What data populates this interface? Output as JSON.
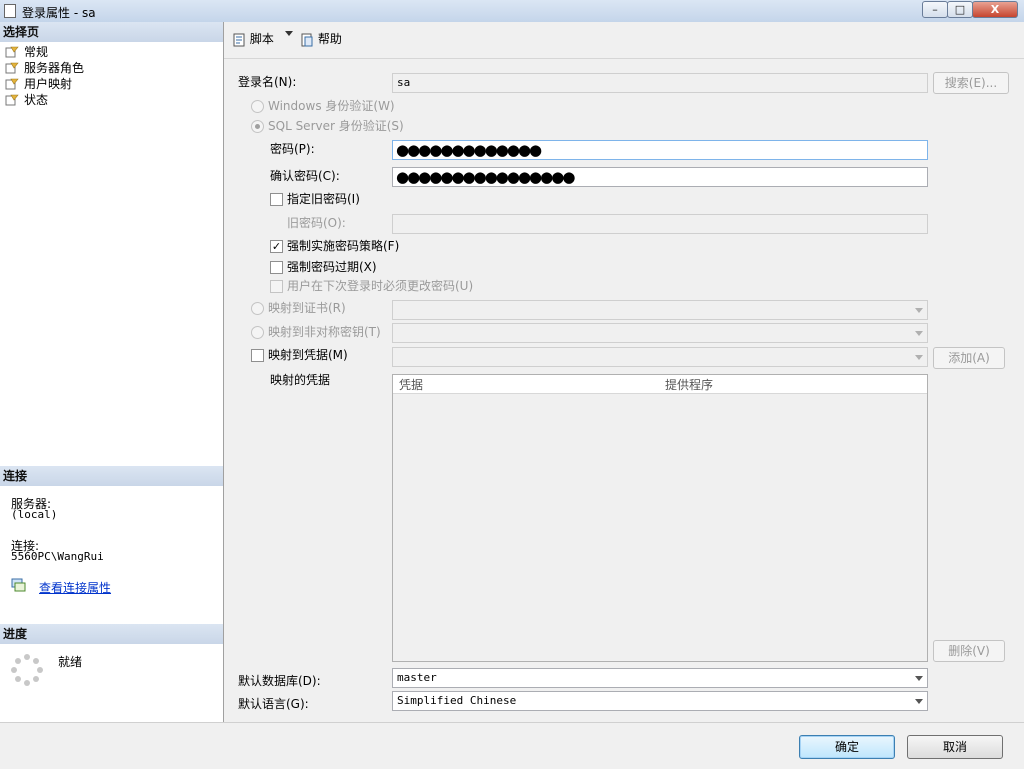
{
  "window": {
    "title": "登录属性 - sa",
    "min_glyph": "–",
    "max_glyph": "□",
    "close_glyph": "X"
  },
  "left": {
    "select_page_header": "选择页",
    "pages": [
      {
        "label": "常规",
        "icon": "page-icon"
      },
      {
        "label": "服务器角色",
        "icon": "page-icon"
      },
      {
        "label": "用户映射",
        "icon": "page-icon"
      },
      {
        "label": "状态",
        "icon": "page-icon"
      }
    ],
    "connection_header": "连接",
    "server_label": "服务器:",
    "server_value": "(local)",
    "connection_label": "连接:",
    "connection_value": "5560PC\\WangRui",
    "view_props_link": "查看连接属性",
    "progress_header": "进度",
    "progress_status": "就绪"
  },
  "toolbar": {
    "script_label": "脚本",
    "help_label": "帮助"
  },
  "form": {
    "login_name_label": "登录名(N):",
    "login_name_value": "sa",
    "search_button": "搜索(E)...",
    "windows_auth_label": "Windows 身份验证(W)",
    "sql_auth_label": "SQL Server 身份验证(S)",
    "password_label": "密码(P):",
    "password_mask": "●●●●●●●●●●●●●",
    "confirm_password_label": "确认密码(C):",
    "confirm_password_mask": "●●●●●●●●●●●●●●●●",
    "specify_old_password_label": "指定旧密码(I)",
    "old_password_label": "旧密码(O):",
    "enforce_policy_label": "强制实施密码策略(F)",
    "enforce_policy_checked": true,
    "enforce_expiration_label": "强制密码过期(X)",
    "must_change_label": "用户在下次登录时必须更改密码(U)",
    "map_cert_label": "映射到证书(R)",
    "map_asym_label": "映射到非对称密钥(T)",
    "map_credential_label": "映射到凭据(M)",
    "add_button": "添加(A)",
    "mapped_credentials_label": "映射的凭据",
    "grid_columns": [
      "凭据",
      "提供程序"
    ],
    "remove_button": "删除(V)",
    "default_db_label": "默认数据库(D):",
    "default_db_value": "master",
    "default_lang_label": "默认语言(G):",
    "default_lang_value": "Simplified Chinese"
  },
  "footer": {
    "ok_button": "确定",
    "cancel_button": "取消"
  }
}
